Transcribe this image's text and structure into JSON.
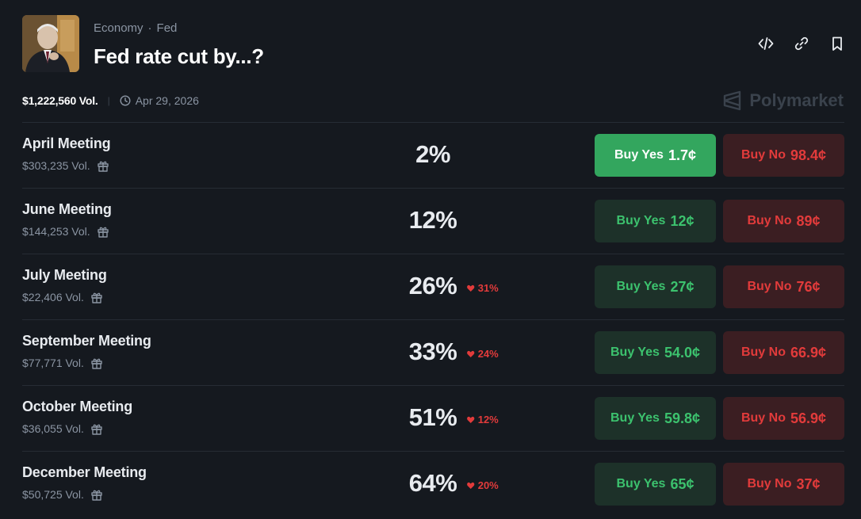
{
  "header": {
    "breadcrumb": [
      "Economy",
      "Fed"
    ],
    "title": "Fed rate cut by...?",
    "total_volume": "$1,222,560 Vol.",
    "end_date": "Apr 29, 2026",
    "brand": "Polymarket"
  },
  "icons": [
    "embed-icon",
    "link-icon",
    "bookmark-icon",
    "clock-icon",
    "gift-icon",
    "heart-icon",
    "polymarket-logo"
  ],
  "colors": {
    "background": "#15191f",
    "yes": "#3cc26e",
    "yes_active_bg": "#33a65e",
    "no": "#e23b3b"
  },
  "markets": [
    {
      "name": "April Meeting",
      "volume": "$303,235 Vol.",
      "percent": "2%",
      "change": "",
      "yes_label": "Buy Yes",
      "yes_price": "1.7¢",
      "no_label": "Buy No",
      "no_price": "98.4¢",
      "selected": true
    },
    {
      "name": "June Meeting",
      "volume": "$144,253 Vol.",
      "percent": "12%",
      "change": "",
      "yes_label": "Buy Yes",
      "yes_price": "12¢",
      "no_label": "Buy No",
      "no_price": "89¢",
      "selected": false
    },
    {
      "name": "July Meeting",
      "volume": "$22,406 Vol.",
      "percent": "26%",
      "change": "31%",
      "yes_label": "Buy Yes",
      "yes_price": "27¢",
      "no_label": "Buy No",
      "no_price": "76¢",
      "selected": false
    },
    {
      "name": "September Meeting",
      "volume": "$77,771 Vol.",
      "percent": "33%",
      "change": "24%",
      "yes_label": "Buy Yes",
      "yes_price": "54.0¢",
      "no_label": "Buy No",
      "no_price": "66.9¢",
      "selected": false
    },
    {
      "name": "October Meeting",
      "volume": "$36,055 Vol.",
      "percent": "51%",
      "change": "12%",
      "yes_label": "Buy Yes",
      "yes_price": "59.8¢",
      "no_label": "Buy No",
      "no_price": "56.9¢",
      "selected": false
    },
    {
      "name": "December Meeting",
      "volume": "$50,725 Vol.",
      "percent": "64%",
      "change": "20%",
      "yes_label": "Buy Yes",
      "yes_price": "65¢",
      "no_label": "Buy No",
      "no_price": "37¢",
      "selected": false
    }
  ]
}
